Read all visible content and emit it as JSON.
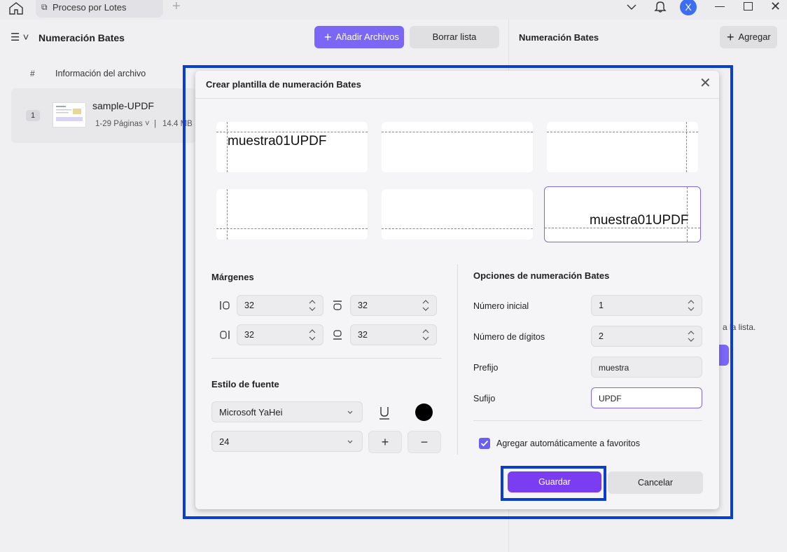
{
  "titlebar": {
    "tab_label": "Proceso por Lotes",
    "avatar_letter": "X"
  },
  "left_panel": {
    "title": "Numeración Bates",
    "add_files_label": "Añadir Archivos",
    "clear_list_label": "Borrar lista",
    "columns": {
      "number": "#",
      "file_info": "Información del archivo"
    },
    "files": [
      {
        "index": "1",
        "name": "sample-UPDF",
        "pages": "1-29 Páginas",
        "size": "14.4 MB"
      }
    ]
  },
  "right_panel": {
    "title": "Numeración Bates",
    "add_label": "Agregar",
    "hint": "a la lista."
  },
  "dialog": {
    "title": "Crear plantilla de numeración Bates",
    "preview_text_top_left": "muestra01UPDF",
    "preview_text_bottom_right": "muestra01UPDF",
    "selected_position": "bottom-right",
    "margins": {
      "title": "Márgenes",
      "left": "32",
      "top": "32",
      "right": "32",
      "bottom": "32"
    },
    "font_style": {
      "title": "Estilo de fuente",
      "font": "Microsoft YaHei",
      "size": "24",
      "color": "#000000"
    },
    "bates_options": {
      "title": "Opciones de numeración Bates",
      "start_number_label": "Número inicial",
      "start_number": "1",
      "digits_label": "Número de dígitos",
      "digits": "2",
      "prefix_label": "Prefijo",
      "prefix": "muestra",
      "suffix_label": "Sufijo",
      "suffix": "UPDF"
    },
    "auto_favorites_label": "Agregar automáticamente a favoritos",
    "auto_favorites_checked": true,
    "save_label": "Guardar",
    "cancel_label": "Cancelar"
  },
  "colors": {
    "accent": "#7b67f6",
    "highlight": "#0a3ecf",
    "save_button": "#7b3df2"
  }
}
